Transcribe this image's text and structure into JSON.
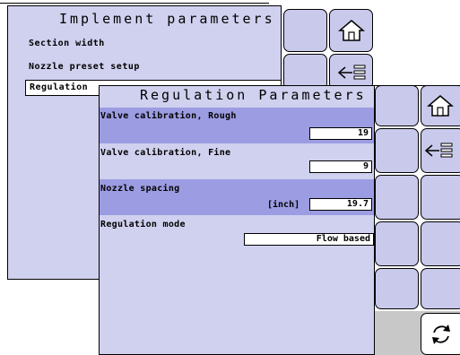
{
  "back_screen": {
    "title": "Implement parameters",
    "items": [
      "Section width",
      "Nozzle preset setup",
      "Regulation"
    ]
  },
  "front_screen": {
    "title": "Regulation Parameters",
    "rows": [
      {
        "label": "Valve calibration, Rough",
        "value": "19",
        "unit": ""
      },
      {
        "label": "Valve calibration, Fine",
        "value": "9",
        "unit": ""
      },
      {
        "label": "Nozzle spacing",
        "value": "19.7",
        "unit": "[inch]"
      },
      {
        "label": "Regulation mode",
        "value": "Flow based",
        "unit": ""
      }
    ]
  },
  "icons": {
    "home": "home-icon",
    "back": "back-list-icon",
    "refresh": "refresh-icon"
  },
  "colors": {
    "panel": "#d0d0ef",
    "highlight": "#9c9ce2",
    "button": "#c9c9ec",
    "footer": "#c8c8c8"
  }
}
